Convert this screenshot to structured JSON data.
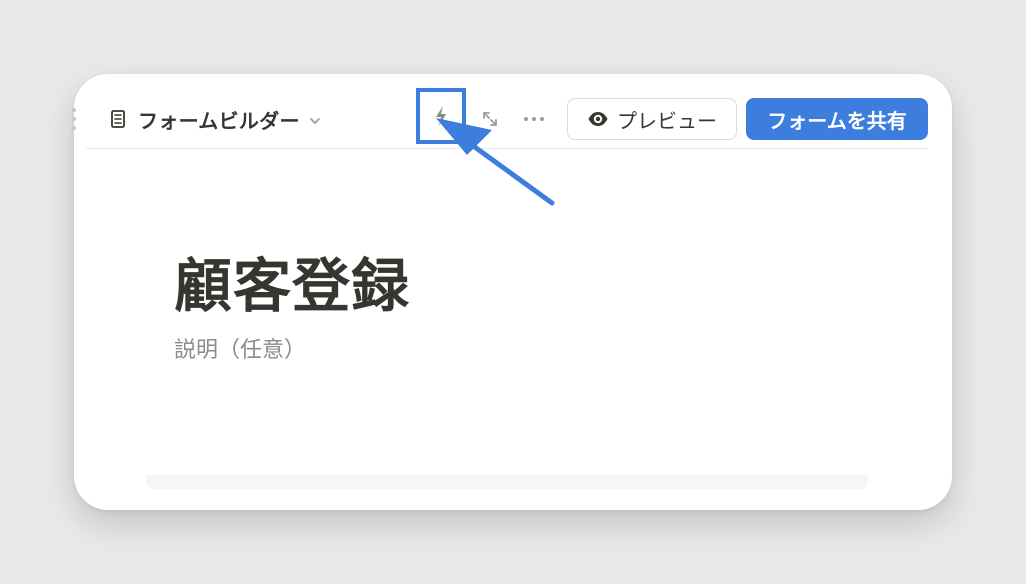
{
  "page": {
    "title": "フォームビルダー",
    "accent_color": "#3d7ddd",
    "text_color": "#37352f",
    "muted_color": "#8d8b86"
  },
  "toolbar": {
    "document_icon": "document-icon",
    "dropdown_icon": "chevron-down-icon",
    "automation_icon": "lightning-bolt-icon",
    "expand_icon": "expand-icon",
    "more_icon": "more-options-icon",
    "preview_icon": "eye-icon",
    "preview_label": "プレビュー",
    "share_label": "フォームを共有"
  },
  "form": {
    "title": "顧客登録",
    "description_placeholder": "説明（任意）"
  },
  "annotation": {
    "highlight_color": "#3d7ddd",
    "arrow_icon": "callout-arrow-icon"
  }
}
